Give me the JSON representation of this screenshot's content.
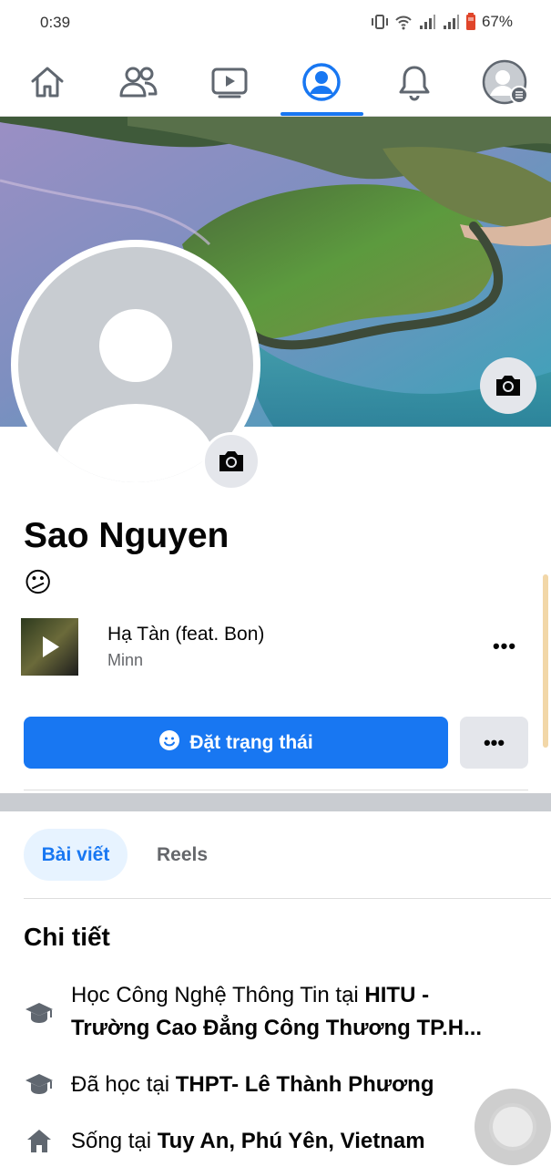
{
  "status_bar": {
    "time": "0:39",
    "battery_percent": "67%",
    "icons": [
      "vibrate-icon",
      "wifi-icon",
      "signal-icon",
      "signal-icon",
      "battery-icon"
    ]
  },
  "nav": {
    "items": [
      "home-icon",
      "friends-icon",
      "video-icon",
      "profile-icon",
      "notifications-icon",
      "menu-avatar-icon"
    ],
    "active": "profile-icon",
    "accent_color": "#1877f2"
  },
  "profile": {
    "name": "Sao Nguyen",
    "status_emoji": "😕"
  },
  "music": {
    "title": "Hạ Tàn (feat. Bon)",
    "artist": "Minn",
    "more_label": "•••"
  },
  "actions": {
    "status_button_label": "Đặt trạng thái",
    "more_label": "•••"
  },
  "tabs": [
    {
      "label": "Bài viết",
      "active": true
    },
    {
      "label": "Reels",
      "active": false
    }
  ],
  "details": {
    "title": "Chi tiết",
    "items": [
      {
        "icon": "education-icon",
        "prefix": "Học Công Nghệ Thông Tin tại ",
        "bold": "HITU - Trường Cao Đẳng Công Thương TP.H..."
      },
      {
        "icon": "education-icon",
        "prefix": "Đã học tại ",
        "bold": "THPT- Lê Thành Phương"
      },
      {
        "icon": "home-icon",
        "prefix": "Sống tại ",
        "bold": "Tuy An, Phú Yên, Vietnam"
      }
    ]
  }
}
